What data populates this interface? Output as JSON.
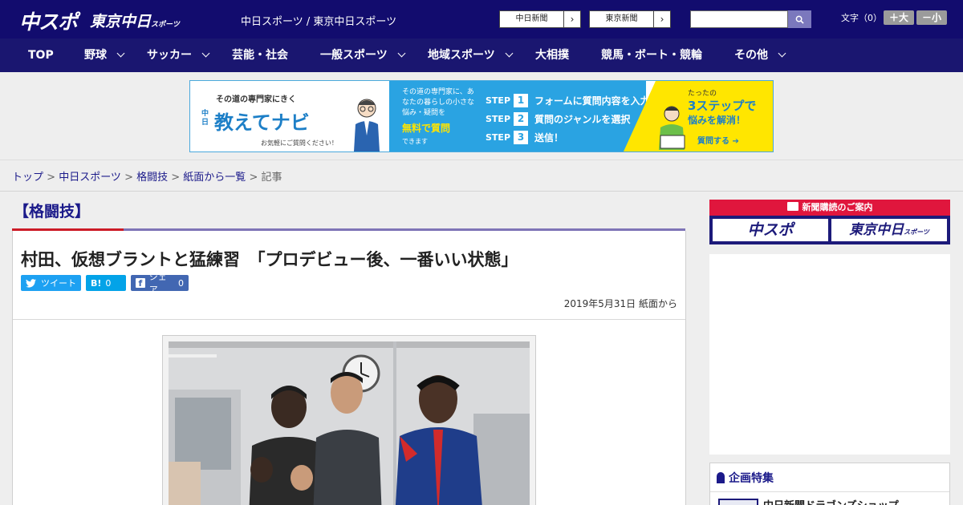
{
  "header": {
    "logo_main": "中スポ",
    "logo_sub": "東京中日",
    "logo_sub_small": "スポーツ",
    "site_title": "中日スポーツ / 東京中日スポーツ",
    "btn_chunichi": "中日新聞",
    "btn_tokyo": "東京新聞",
    "font_size_label": "文字（0）",
    "font_plus": "＋大",
    "font_minus": "－小"
  },
  "nav": {
    "items": [
      {
        "label": "TOP"
      },
      {
        "label": "野球"
      },
      {
        "label": "サッカー"
      },
      {
        "label": "芸能・社会"
      },
      {
        "label": "一般スポーツ"
      },
      {
        "label": "地域スポーツ"
      },
      {
        "label": "大相撲"
      },
      {
        "label": "競馬・ボート・競輪"
      },
      {
        "label": "その他"
      }
    ]
  },
  "banner": {
    "tagline": "その道の専門家にきく",
    "brand_small": "中日",
    "brand_name": "教えてナビ",
    "note": "お気軽にご質問ください！",
    "mid_text": "その道の専門家に、あなたの暮らしの小さな悩み・疑問を",
    "mid_free": "無料で質問",
    "mid_tail": "できます",
    "steps": [
      {
        "label": "STEP",
        "num": "1",
        "text": "フォームに質問内容を入力"
      },
      {
        "label": "STEP",
        "num": "2",
        "text": "質問のジャンルを選択"
      },
      {
        "label": "STEP",
        "num": "3",
        "text": "送信！"
      }
    ],
    "right_a": "たったの",
    "right_b": "3ステップで",
    "right_c": "悩みを解消！",
    "right_d": "質問する ➔"
  },
  "breadcrumb": {
    "items": [
      "トップ",
      "中日スポーツ",
      "格闘技",
      "紙面から一覧"
    ],
    "current": "記事",
    "separator": " > "
  },
  "article": {
    "category": "【格闘技】",
    "headline": "村田、仮想ブラントと猛練習　「プロデビュー後、一番いい状態」",
    "tweet_label": "ツイート",
    "hatena_label": "B!",
    "hatena_count": "0",
    "facebook_label": "シェア",
    "facebook_count": "0",
    "date": "2019年5月31日 紙面から",
    "photo_alt": "boxers"
  },
  "sidebar": {
    "subscription_title": "新聞購読のご案内",
    "sub_logo_1": "中スポ",
    "sub_logo_2": "東京中日",
    "sub_logo_2_small": "スポーツ",
    "feature_title": "企画特集",
    "feature_item": "中日新聞ドラゴンズショップ"
  },
  "colors": {
    "header_bg": "#120c6e",
    "nav_bg": "#1a1670",
    "accent_red": "#cc1b27",
    "accent_purple": "#7e74b6",
    "link": "#1b1a8a"
  }
}
